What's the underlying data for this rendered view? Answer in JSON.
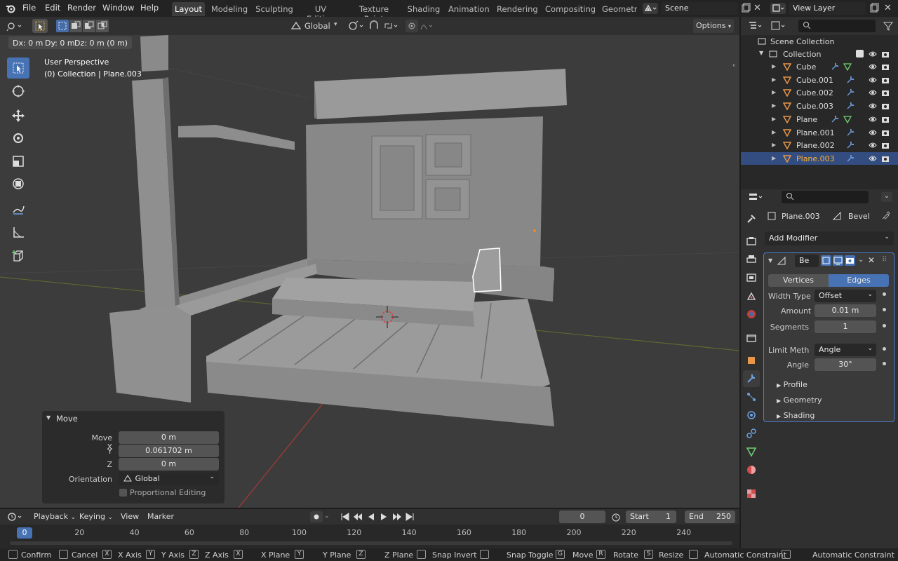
{
  "topbar": {
    "menus": [
      "File",
      "Edit",
      "Render",
      "Window",
      "Help"
    ],
    "workspaces": [
      "Layout",
      "Modeling",
      "Sculpting",
      "UV Editing",
      "Texture Paint",
      "Shading",
      "Animation",
      "Rendering",
      "Compositing",
      "Geometr"
    ],
    "scene": "Scene",
    "view_layer": "View Layer"
  },
  "viewport": {
    "header": {
      "orientation": "Global",
      "options": "Options"
    },
    "delta_readout": {
      "dx": "Dx: 0 m",
      "dy": "Dy: 0 m",
      "dz": "Dz: 0 m (0 m)"
    },
    "perspective": "User Perspective",
    "collection_info": "(0) Collection | Plane.003"
  },
  "operator_panel": {
    "title": "Move",
    "move_x_label": "Move X",
    "move_x": "0 m",
    "y_label": "Y",
    "y": "0.061702 m",
    "z_label": "Z",
    "z": "0 m",
    "orientation_label": "Orientation",
    "orientation": "Global",
    "proportional": "Proportional Editing"
  },
  "outliner": {
    "root": "Scene Collection",
    "collection": "Collection",
    "items": [
      {
        "name": "Cube",
        "selected": false,
        "mesh_icon": true
      },
      {
        "name": "Cube.001",
        "selected": false,
        "mesh_icon": false
      },
      {
        "name": "Cube.002",
        "selected": false,
        "mesh_icon": false
      },
      {
        "name": "Cube.003",
        "selected": false,
        "mesh_icon": false
      },
      {
        "name": "Plane",
        "selected": false,
        "mesh_icon": true
      },
      {
        "name": "Plane.001",
        "selected": false,
        "mesh_icon": false
      },
      {
        "name": "Plane.002",
        "selected": false,
        "mesh_icon": false
      },
      {
        "name": "Plane.003",
        "selected": true,
        "mesh_icon": false
      }
    ]
  },
  "properties": {
    "object": "Plane.003",
    "modifier_name": "Bevel",
    "add_modifier": "Add Modifier",
    "modifier_short": "Be",
    "mode_vertices": "Vertices",
    "mode_edges": "Edges",
    "width_type_label": "Width Type",
    "width_type": "Offset",
    "amount_label": "Amount",
    "amount": "0.01 m",
    "segments_label": "Segments",
    "segments": "1",
    "limit_label": "Limit Meth",
    "limit": "Angle",
    "angle_label": "Angle",
    "angle": "30°",
    "subpanels": [
      "Profile",
      "Geometry",
      "Shading"
    ]
  },
  "timeline": {
    "playback": "Playback",
    "keying": "Keying",
    "view": "View",
    "marker": "Marker",
    "current_frame": "0",
    "start_label": "Start",
    "start": "1",
    "end_label": "End",
    "end": "250",
    "ruler": [
      "0",
      "20",
      "40",
      "60",
      "80",
      "100",
      "120",
      "140",
      "160",
      "180",
      "200",
      "220",
      "240"
    ]
  },
  "statusbar": [
    {
      "key": "",
      "label": "Confirm"
    },
    {
      "key": "",
      "label": "Cancel"
    },
    {
      "key": "X",
      "label": "X Axis"
    },
    {
      "key": "Y",
      "label": "Y Axis"
    },
    {
      "key": "Z",
      "label": "Z Axis"
    },
    {
      "key": "X",
      "label": "X Plane"
    },
    {
      "key": "Y",
      "label": "Y Plane"
    },
    {
      "key": "Z",
      "label": "Z Plane"
    },
    {
      "key": "",
      "label": "Snap Invert"
    },
    {
      "key": "",
      "label": "Snap Toggle"
    },
    {
      "key": "G",
      "label": "Move"
    },
    {
      "key": "R",
      "label": "Rotate"
    },
    {
      "key": "S",
      "label": "Resize"
    },
    {
      "key": "",
      "label": "Automatic Constraint"
    },
    {
      "key": "",
      "label": "Automatic Constraint Pla"
    }
  ],
  "colors": {
    "accent": "#4772b3",
    "selected_row": "#334d80",
    "mesh_orange": "#e8964a",
    "modifier_blue": "#4b7fd1"
  }
}
